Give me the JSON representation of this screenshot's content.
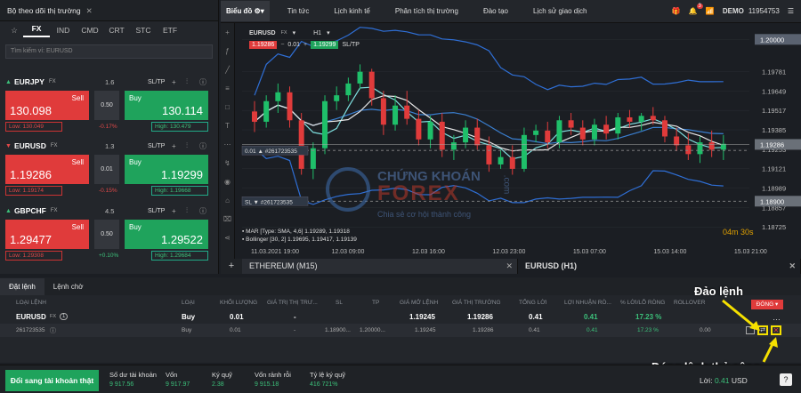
{
  "market_watch": {
    "title": "Bộ theo dõi thị trường",
    "tabs": [
      "FX",
      "IND",
      "CMD",
      "CRT",
      "STC",
      "ETF"
    ],
    "active_tab": "FX",
    "search_placeholder": "Tìm kiếm ví: EURUSD"
  },
  "symbols": [
    {
      "name": "EURJPY",
      "type": "FX",
      "spread": "1.6",
      "sltp": "SL/TP",
      "sell_label": "Sell",
      "buy_label": "Buy",
      "sell": "130.098",
      "buy": "130.114",
      "qty": "0.50",
      "low": "Low: 130.049",
      "high": "High: 130.479",
      "change": "-0.17%",
      "dir": "up"
    },
    {
      "name": "EURUSD",
      "type": "FX",
      "spread": "1.3",
      "sltp": "SL/TP",
      "sell_label": "Sell",
      "buy_label": "Buy",
      "sell": "1.19286",
      "buy": "1.19299",
      "qty": "0.01",
      "low": "Low: 1.19174",
      "high": "High: 1.19668",
      "change": "-0.15%",
      "dir": "down"
    },
    {
      "name": "GBPCHF",
      "type": "FX",
      "spread": "4.5",
      "sltp": "SL/TP",
      "sell_label": "Sell",
      "buy_label": "Buy",
      "sell": "1.29477",
      "buy": "1.29522",
      "qty": "0.50",
      "low": "Low: 1.29308",
      "high": "High: 1.29684",
      "change": "+0.10%",
      "dir": "up"
    }
  ],
  "chart_tabs": [
    "Biểu đồ",
    "Tin tức",
    "Lịch kinh tế",
    "Phân tích thị trường",
    "Đào tạo",
    "Lịch sử giao dịch"
  ],
  "account": {
    "mode": "DEMO",
    "number": "11954753",
    "notif": "3"
  },
  "chart": {
    "symbol": "EURUSD",
    "suffix": "FX",
    "tf": "H1",
    "sell": "1.19286",
    "lots": "0.01",
    "buy": "1.19299",
    "sltp": "SL/TP",
    "indicator1": "MAR [Type: SMA, 4,6] 1.19289, 1.19318",
    "indicator2": "Bollinger [30, 2] 1.19695, 1.19417, 1.19139",
    "timer": "04m 30s",
    "pos_line": "0.01 ▲ #261723535",
    "sl_line": "SL ▼ #261723535"
  },
  "chart_data": {
    "type": "candlestick",
    "symbol": "EURUSD",
    "timeframe": "H1",
    "x_labels": [
      "11.03.2021 19:00",
      "12.03 09:00",
      "12.03 16:00",
      "12.03 23:00",
      "15.03 07:00",
      "15.03 14:00",
      "15.03 21:00"
    ],
    "y_ticks": [
      "1.20000",
      "1.19781",
      "1.19649",
      "1.19517",
      "1.19385",
      "1.19253",
      "1.19121",
      "1.18989",
      "1.18857",
      "1.18725"
    ],
    "current_price": "1.19286",
    "sl_price": "1.18900",
    "position_price": "1.19245",
    "ylim": [
      1.1866,
      1.2005
    ],
    "ohlc": [
      [
        1.1951,
        1.1958,
        1.1937,
        1.1944
      ],
      [
        1.1944,
        1.1962,
        1.194,
        1.1958
      ],
      [
        1.1958,
        1.197,
        1.195,
        1.1964
      ],
      [
        1.1964,
        1.1968,
        1.194,
        1.1945
      ],
      [
        1.1945,
        1.195,
        1.1908,
        1.1912
      ],
      [
        1.1912,
        1.193,
        1.1905,
        1.1926
      ],
      [
        1.1926,
        1.1962,
        1.1922,
        1.1958
      ],
      [
        1.1958,
        1.1968,
        1.1952,
        1.1962
      ],
      [
        1.1962,
        1.1974,
        1.1958,
        1.197
      ],
      [
        1.197,
        1.1983,
        1.1966,
        1.1978
      ],
      [
        1.1978,
        1.198,
        1.1955,
        1.196
      ],
      [
        1.196,
        1.1965,
        1.1935,
        1.1942
      ],
      [
        1.1942,
        1.1962,
        1.1938,
        1.1955
      ],
      [
        1.1955,
        1.1965,
        1.1942,
        1.1946
      ],
      [
        1.1946,
        1.1952,
        1.1928,
        1.1932
      ],
      [
        1.1932,
        1.1948,
        1.1926,
        1.1944
      ],
      [
        1.1944,
        1.195,
        1.192,
        1.1925
      ],
      [
        1.1925,
        1.1935,
        1.1918,
        1.193
      ],
      [
        1.193,
        1.1945,
        1.1926,
        1.194
      ],
      [
        1.194,
        1.1946,
        1.1925,
        1.1928
      ],
      [
        1.1928,
        1.1934,
        1.191,
        1.1915
      ],
      [
        1.1915,
        1.1925,
        1.1912,
        1.192
      ],
      [
        1.192,
        1.1928,
        1.1908,
        1.1912
      ],
      [
        1.1912,
        1.194,
        1.191,
        1.1935
      ],
      [
        1.1935,
        1.1942,
        1.193,
        1.1938
      ],
      [
        1.1938,
        1.1944,
        1.1926,
        1.193
      ],
      [
        1.193,
        1.1948,
        1.1926,
        1.1945
      ],
      [
        1.1945,
        1.195,
        1.1935,
        1.194
      ],
      [
        1.194,
        1.1945,
        1.1928,
        1.1932
      ],
      [
        1.1932,
        1.1946,
        1.1928,
        1.1942
      ],
      [
        1.1942,
        1.1948,
        1.1932,
        1.1936
      ],
      [
        1.1936,
        1.195,
        1.1932,
        1.1947
      ],
      [
        1.1947,
        1.1952,
        1.194,
        1.1944
      ],
      [
        1.1944,
        1.195,
        1.1938,
        1.1948
      ],
      [
        1.1948,
        1.1954,
        1.1942,
        1.1945
      ],
      [
        1.1945,
        1.1948,
        1.193,
        1.1934
      ],
      [
        1.1934,
        1.194,
        1.1924,
        1.1928
      ],
      [
        1.1928,
        1.1936,
        1.1918,
        1.1922
      ],
      [
        1.1922,
        1.1934,
        1.1916,
        1.193
      ],
      [
        1.193,
        1.1938,
        1.192,
        1.1925
      ],
      [
        1.1925,
        1.1935,
        1.1918,
        1.1929
      ]
    ]
  },
  "bottom_tabs": [
    "ETHEREUM (M15)",
    "EURUSD (H1)"
  ],
  "watermark": {
    "line1": "CHỨNG KHOÁN",
    "line2": "FOREX",
    "line3": "Chia sẻ cơ hội thành công",
    "side": ".com"
  },
  "order_tabs": [
    "Đặt lệnh",
    "Lệnh chờ"
  ],
  "order_headers": [
    "LOẠI LỆNH",
    "LOẠI",
    "KHỐI LƯỢNG",
    "GIÁ TRỊ THỊ TRƯ...",
    "SL",
    "TP",
    "GIÁ MỞ LỆNH",
    "GIÁ THỊ TRƯỜNG",
    "TỔNG LỜI",
    "LỢI NHUẬN RÒ...",
    "% LỜI/LỖ RÒNG",
    "ROLLOVER"
  ],
  "order_group": {
    "symbol": "EURUSD",
    "type": "FX",
    "count": "1",
    "side": "Buy",
    "volume": "0.01",
    "market_value": "-",
    "open": "1.19245",
    "market": "1.19286",
    "profit": "0.41",
    "net": "0.41",
    "pct": "17.23 %"
  },
  "order_row": {
    "id": "261723535",
    "side": "Buy",
    "volume": "0.01",
    "market_value": "-",
    "sl": "1.18900...",
    "tp": "1.20000...",
    "open": "1.19245",
    "market": "1.19286",
    "profit": "0.41",
    "net": "0.41",
    "pct": "17.23 %",
    "rollover": "0.00"
  },
  "close_all": "ĐÓNG",
  "annotations": {
    "reverse": "Đảo lệnh",
    "close": "Đóng lệnh thủ công"
  },
  "footer": {
    "real_btn": "Đổi sang tài khoản thật",
    "cells": [
      {
        "label": "Số dư tài khoản",
        "value": "9 917.56"
      },
      {
        "label": "Vốn",
        "value": "9 917.97"
      },
      {
        "label": "Ký quỹ",
        "value": "2.38"
      },
      {
        "label": "Vốn rảnh rỗi",
        "value": "9 915.18"
      },
      {
        "label": "Tỷ lệ ký quỹ",
        "value": "416 721%"
      }
    ],
    "profit_label": "Lời:",
    "profit": "0.41",
    "currency": "USD"
  }
}
